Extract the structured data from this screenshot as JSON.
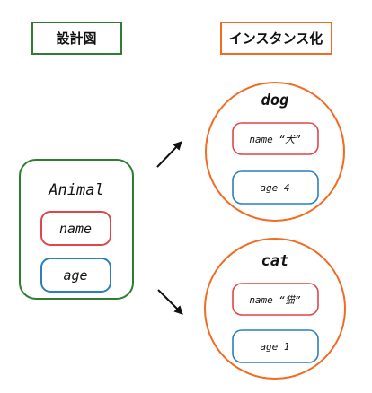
{
  "labels": {
    "blueprint": "設計図",
    "instantiation": "インスタンス化"
  },
  "class_box": {
    "title": "Animal",
    "fields": [
      "name",
      "age"
    ]
  },
  "instances": [
    {
      "title": "dog",
      "fields": [
        "name “犬”",
        "age 4"
      ]
    },
    {
      "title": "cat",
      "fields": [
        "name “猫”",
        "age 1"
      ]
    }
  ],
  "colors": {
    "green": "#2e7d32",
    "orange": "#f26b21",
    "red": "#e0454a",
    "blue": "#2b7fc0",
    "arrow": "#111111"
  }
}
